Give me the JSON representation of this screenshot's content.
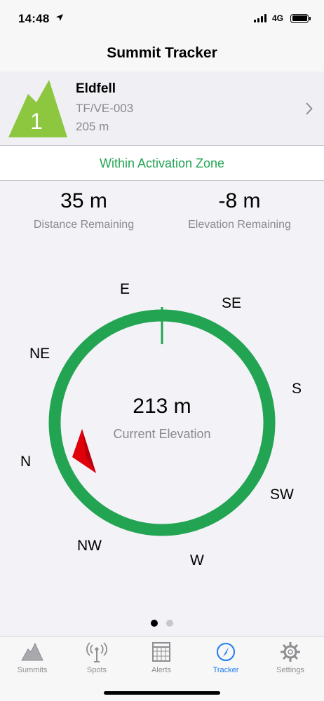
{
  "status_bar": {
    "time": "14:48",
    "network": "4G"
  },
  "nav": {
    "title": "Summit Tracker"
  },
  "summit": {
    "rank": "1",
    "name": "Eldfell",
    "reference": "TF/VE-003",
    "altitude": "205 m"
  },
  "zone": {
    "status": "Within Activation Zone",
    "color": "#23a453"
  },
  "stats": {
    "distance": {
      "value": "35 m",
      "label": "Distance Remaining"
    },
    "elevation": {
      "value": "-8 m",
      "label": "Elevation Remaining"
    }
  },
  "compass": {
    "directions": [
      "E",
      "SE",
      "S",
      "SW",
      "W",
      "NW",
      "N",
      "NE"
    ],
    "current_elevation": "213 m",
    "current_elevation_label": "Current Elevation",
    "ring_color": "#23a453",
    "needle_color": "#e0000b"
  },
  "pager": {
    "pages": 2,
    "active": 1
  },
  "tabs": [
    {
      "label": "Summits",
      "icon": "mountain-icon",
      "active": false
    },
    {
      "label": "Spots",
      "icon": "antenna-icon",
      "active": false
    },
    {
      "label": "Alerts",
      "icon": "calendar-icon",
      "active": false
    },
    {
      "label": "Tracker",
      "icon": "compass-icon",
      "active": true
    },
    {
      "label": "Settings",
      "icon": "gear-icon",
      "active": false
    }
  ]
}
